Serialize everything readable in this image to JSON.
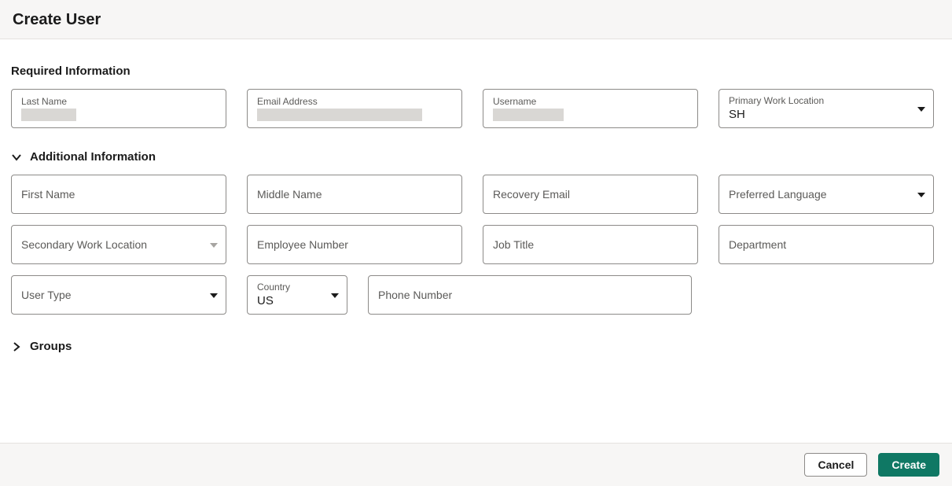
{
  "header": {
    "title": "Create User"
  },
  "sections": {
    "required": {
      "title": "Required Information",
      "fields": {
        "last_name_label": "Last Name",
        "email_label": "Email Address",
        "username_label": "Username",
        "primary_work_location_label": "Primary Work Location",
        "primary_work_location_value": "SH"
      }
    },
    "additional": {
      "title": "Additional Information",
      "fields": {
        "first_name_label": "First Name",
        "middle_name_label": "Middle Name",
        "recovery_email_label": "Recovery Email",
        "preferred_language_label": "Preferred Language",
        "secondary_work_location_label": "Secondary Work Location",
        "employee_number_label": "Employee Number",
        "job_title_label": "Job Title",
        "department_label": "Department",
        "user_type_label": "User Type",
        "country_label": "Country",
        "country_value": "US",
        "phone_number_label": "Phone Number"
      }
    },
    "groups": {
      "title": "Groups"
    }
  },
  "footer": {
    "cancel_label": "Cancel",
    "create_label": "Create"
  }
}
